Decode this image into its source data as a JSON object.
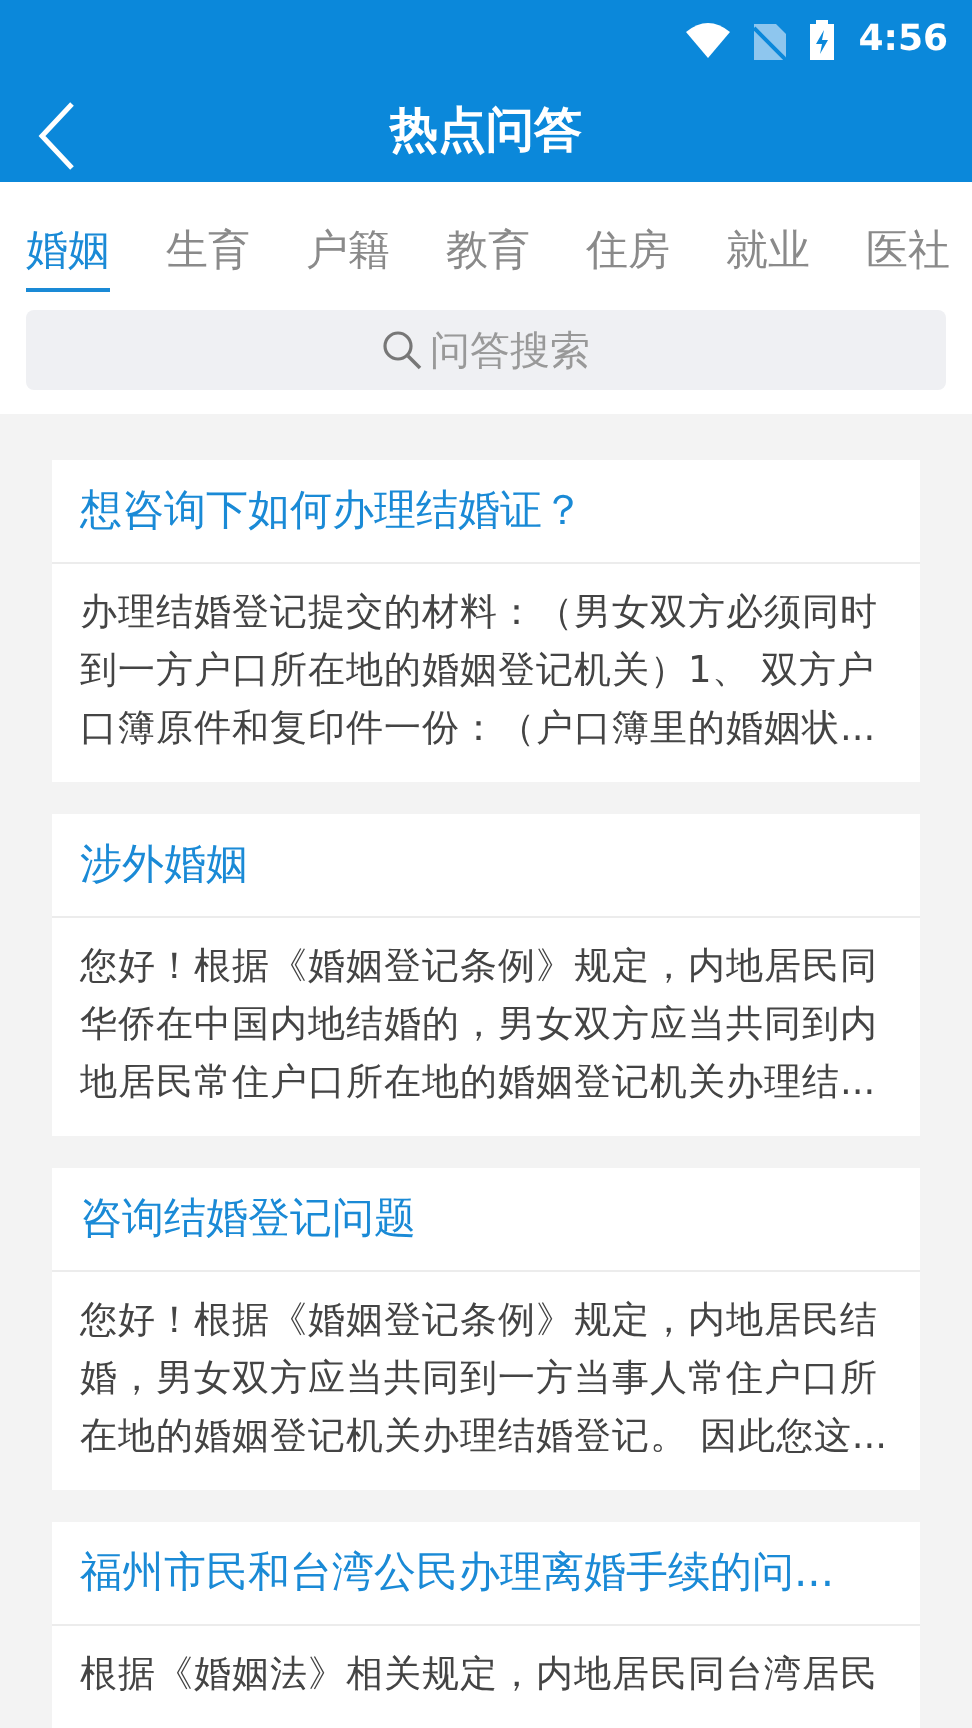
{
  "status_bar": {
    "time": "4:56"
  },
  "header": {
    "title": "热点问答"
  },
  "tabs": [
    {
      "label": "婚姻",
      "selected": true
    },
    {
      "label": "生育",
      "selected": false
    },
    {
      "label": "户籍",
      "selected": false
    },
    {
      "label": "教育",
      "selected": false
    },
    {
      "label": "住房",
      "selected": false
    },
    {
      "label": "就业",
      "selected": false
    },
    {
      "label": "医社",
      "selected": false
    }
  ],
  "search": {
    "placeholder": "问答搜索"
  },
  "questions": [
    {
      "title": "想咨询下如何办理结婚证？",
      "answer": "办理结婚登记提交的材料：（男女双方必须同时到一方户口所在地的婚姻登记机关）1、 双方户口簿原件和复印件一份：（户口簿里的婚姻状..."
    },
    {
      "title": "涉外婚姻",
      "answer": "您好！根据《婚姻登记条例》规定，内地居民同华侨在中国内地结婚的，男女双方应当共同到内地居民常住户口所在地的婚姻登记机关办理结..."
    },
    {
      "title": "咨询结婚登记问题",
      "answer": "您好！根据《婚姻登记条例》规定，内地居民结婚，男女双方应当共同到一方当事人常住户口所在地的婚姻登记机关办理结婚登记。 因此您这..."
    },
    {
      "title": "福州市民和台湾公民办理离婚手续的问...",
      "answer": "根据《婚姻法》相关规定，内地居民同台湾居民"
    }
  ]
}
